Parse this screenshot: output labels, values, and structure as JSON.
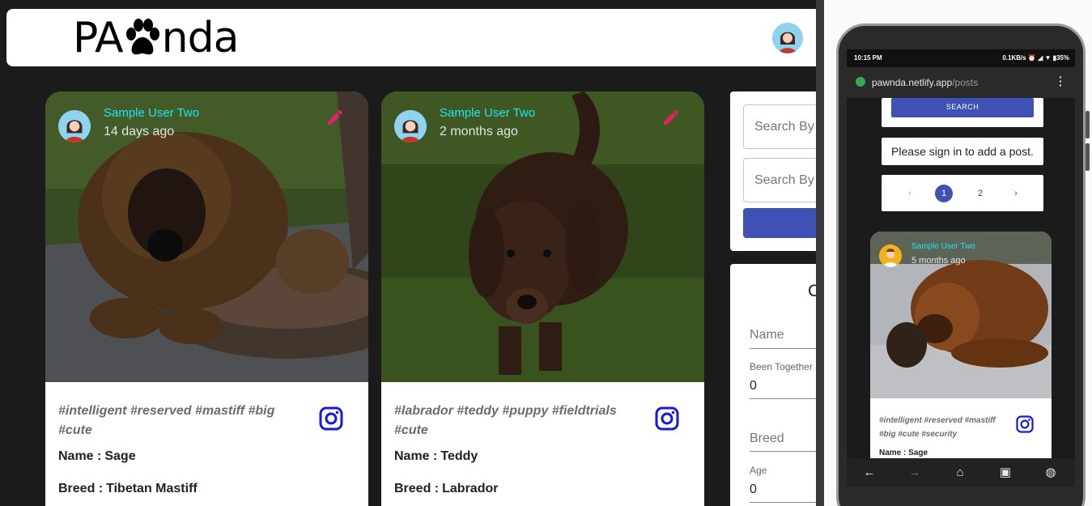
{
  "app": {
    "logo_left": "PA",
    "logo_right": "nda"
  },
  "posts": [
    {
      "user": "Sample User Two",
      "time": "14 days ago",
      "tags": "#intelligent #reserved #mastiff #big #cute",
      "name_label": "Name :",
      "name": "Sage",
      "breed_label": "Breed :",
      "breed": "Tibetan Mastiff"
    },
    {
      "user": "Sample User Two",
      "time": "2 months ago",
      "tags": "#labrador #teddy #puppy #fieldtrials #cute",
      "name_label": "Name :",
      "name": "Teddy",
      "breed_label": "Breed :",
      "breed": "Labrador"
    }
  ],
  "sidebar": {
    "search1_placeholder": "Search By",
    "search2_placeholder": "Search By",
    "form_title": "C",
    "name_label": "Name",
    "been_together_label": "Been Together",
    "been_together_value": "0",
    "breed_label": "Breed",
    "age_label": "Age",
    "age_value": "0"
  },
  "phone": {
    "status_time": "10:15 PM",
    "status_right": "0.1KB/s ⏰ ◢ ▼ ▮35%",
    "url_host": "pawnda.netlify.app",
    "url_path": "/posts",
    "search_button": "SEARCH",
    "signin_msg": "Please sign in to add a post.",
    "pager": {
      "prev": "‹",
      "pages": [
        "1",
        "2"
      ],
      "active": "1",
      "next": "›"
    },
    "post": {
      "user": "Sample User Two",
      "time": "5 months ago",
      "tags": "#intelligent #reserved #mastiff #big #cute #security",
      "name_line": "Name : Sage"
    },
    "nav": [
      "←",
      "→",
      "⌂",
      "▣",
      "◍"
    ]
  },
  "colors": {
    "accent": "#3f51b5",
    "username": "#1ee8f0",
    "edit": "#e91e63",
    "instagram": "#1a1ad6",
    "page_bg": "#1b1b1c"
  }
}
